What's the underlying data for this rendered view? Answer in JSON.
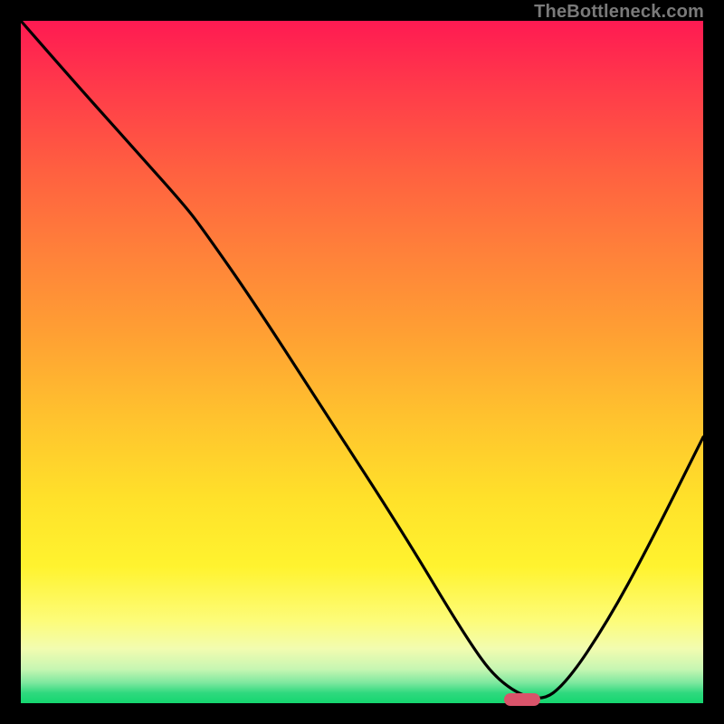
{
  "watermark": "TheBottleneck.com",
  "marker": {
    "x_frac": 0.735,
    "y_frac": 0.995,
    "color": "#d9536a"
  },
  "chart_data": {
    "type": "line",
    "title": "",
    "xlabel": "",
    "ylabel": "",
    "xlim": [
      0,
      1
    ],
    "ylim": [
      0,
      1
    ],
    "grid": false,
    "series": [
      {
        "name": "curve",
        "x": [
          0.0,
          0.07,
          0.15,
          0.24,
          0.27,
          0.34,
          0.45,
          0.56,
          0.65,
          0.7,
          0.76,
          0.8,
          0.86,
          0.92,
          1.0
        ],
        "y": [
          1.0,
          0.92,
          0.83,
          0.73,
          0.69,
          0.59,
          0.42,
          0.25,
          0.1,
          0.03,
          0.0,
          0.03,
          0.12,
          0.23,
          0.39
        ]
      }
    ],
    "background_gradient": [
      {
        "stop": 0.0,
        "color": "#ff1a52"
      },
      {
        "stop": 0.5,
        "color": "#ffb030"
      },
      {
        "stop": 0.85,
        "color": "#fff84a"
      },
      {
        "stop": 1.0,
        "color": "#14d66f"
      }
    ]
  }
}
